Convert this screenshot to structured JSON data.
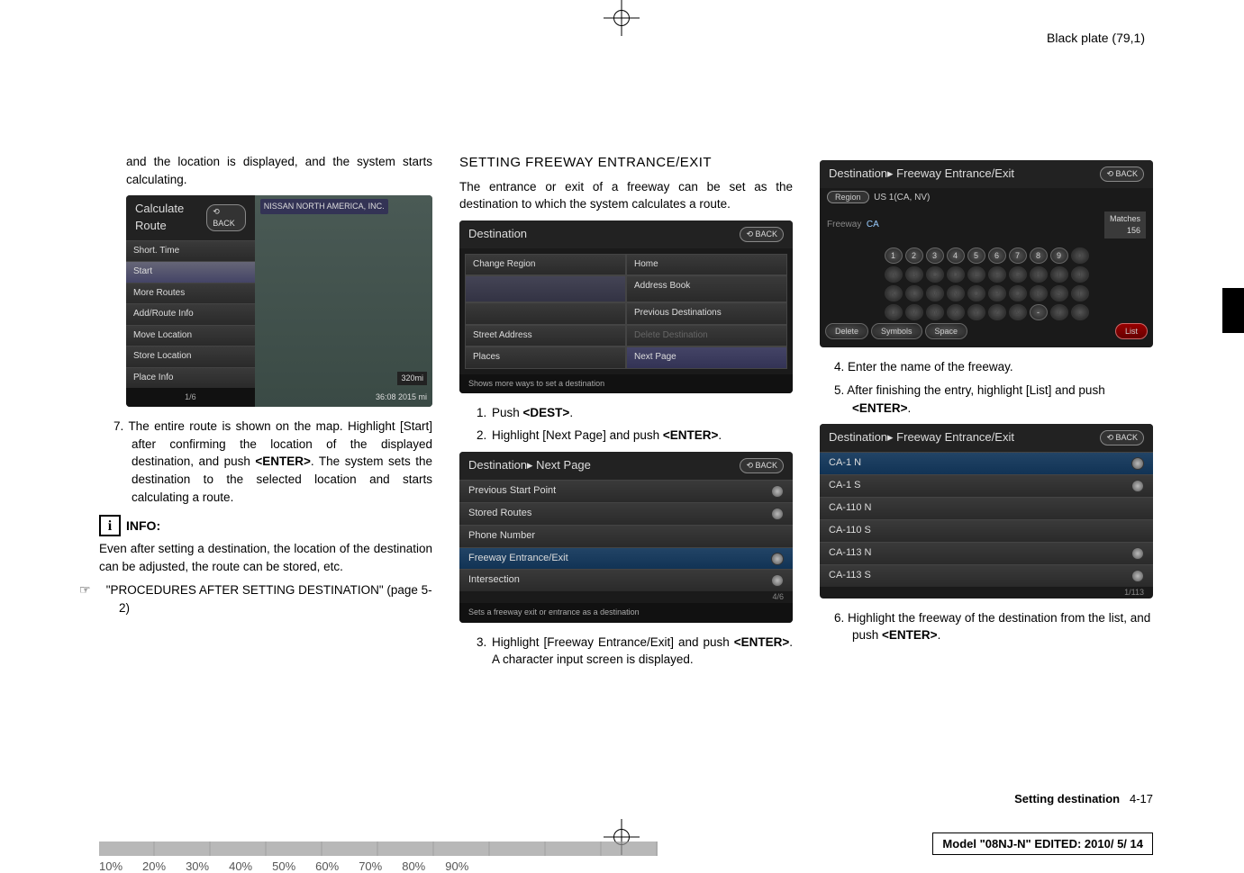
{
  "header": {
    "plate": "Black plate (79,1)"
  },
  "col1": {
    "intro": "and the location is displayed, and the system starts calculating.",
    "calc_title": "Calculate Route",
    "back": "BACK",
    "calc_items": [
      "Short. Time",
      "Start",
      "More Routes",
      "Add/Route Info",
      "Move Location",
      "Store Location",
      "Place Info"
    ],
    "map_label": "NISSAN NORTH AMERICA, INC.",
    "map_dist": "320mi",
    "map_foot_l": "1/6",
    "map_foot_r": "36:08   2015 mi",
    "step7": "The entire route is shown on the map. Highlight [Start] after confirming the location of the displayed destination, and push <ENTER>. The system sets the destination to the selected location and starts calculating a route.",
    "info_label": "INFO:",
    "info_body": "Even after setting a destination, the location of the destination can be adjusted, the route can be stored, etc.",
    "ref": "\"PROCEDURES AFTER SETTING DESTINATION\" (page 5-2)"
  },
  "col2": {
    "heading": "SETTING FREEWAY ENTRANCE/EXIT",
    "intro": "The entrance or exit of a freeway can be set as the destination to which the system calculates a route.",
    "dest_title": "Destination",
    "back": "BACK",
    "left_items": [
      "Change Region",
      "Street Address",
      "Places"
    ],
    "right_items": [
      "Home",
      "Address Book",
      "Previous Destinations",
      "Delete Destination",
      "Next Page"
    ],
    "foot1": "Shows more ways to set a destination",
    "step1": "Push <DEST>.",
    "step2": "Highlight [Next Page] and push <ENTER>.",
    "next_title": "Destination▸ Next Page",
    "next_items": [
      "Previous Start Point",
      "Stored Routes",
      "Phone Number",
      "Freeway Entrance/Exit",
      "Intersection"
    ],
    "next_count": "4/6",
    "foot2": "Sets a freeway exit or entrance as a destination",
    "step3": "Highlight [Freeway Entrance/Exit] and push <ENTER>. A character input screen is displayed."
  },
  "col3": {
    "kb_title": "Destination▸ Freeway Entrance/Exit",
    "back": "BACK",
    "region_btn": "Region",
    "region_val": "US 1(CA, NV)",
    "freeway_lbl": "Freeway",
    "freeway_val": "CA",
    "matches_lbl": "Matches",
    "matches_val": "156",
    "row1": [
      "1",
      "2",
      "3",
      "4",
      "5",
      "6",
      "7",
      "8",
      "9",
      "0"
    ],
    "row2": [
      "A",
      "B",
      "C",
      "D",
      "E",
      "F",
      "G",
      "H",
      "I",
      "J"
    ],
    "row3": [
      "K",
      "L",
      "M",
      "N",
      "O",
      "P",
      "Q",
      "R",
      "S",
      "T"
    ],
    "row4": [
      "U",
      "V",
      "W",
      "X",
      "Y",
      "Z",
      "&",
      "-",
      "/",
      "."
    ],
    "kb_btns": [
      "Delete",
      "Symbols",
      "Space",
      "List"
    ],
    "step4": "Enter the name of the freeway.",
    "step5": "After finishing the entry, highlight [List] and push <ENTER>.",
    "list_title": "Destination▸ Freeway Entrance/Exit",
    "list_items": [
      "CA-1 N",
      "CA-1 S",
      "CA-110 N",
      "CA-110 S",
      "CA-113 N",
      "CA-113 S"
    ],
    "list_count": "1/113",
    "step6": "Highlight the freeway of the destination from the list, and push <ENTER>."
  },
  "footer": {
    "percents": [
      "10%",
      "20%",
      "30%",
      "40%",
      "50%",
      "60%",
      "70%",
      "80%",
      "90%"
    ],
    "setting": "Setting destination",
    "page": "4-17",
    "model": "Model \"08NJ-N\"   EDITED:  2010/ 5/ 14"
  }
}
